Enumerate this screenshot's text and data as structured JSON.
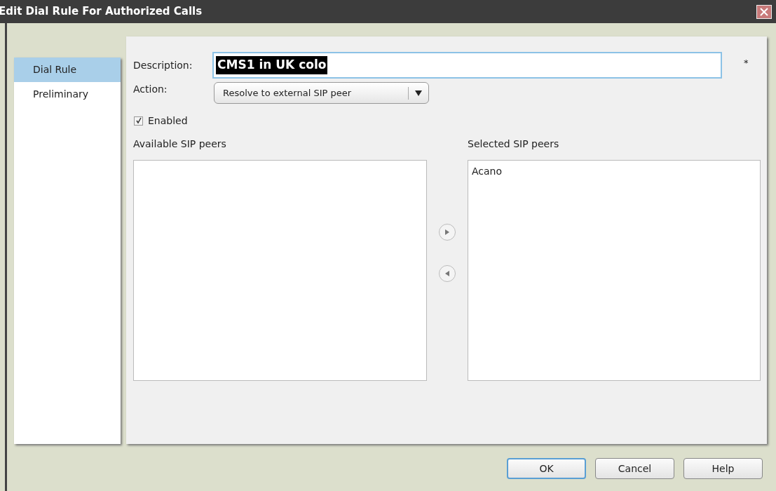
{
  "window": {
    "title": "Edit Dial Rule For Authorized Calls"
  },
  "sidebar": {
    "items": [
      {
        "label": "Dial Rule",
        "selected": true
      },
      {
        "label": "Preliminary",
        "selected": false
      }
    ]
  },
  "form": {
    "description": {
      "label": "Description:",
      "value": "CMS1 in UK colo",
      "value_selected": true,
      "required_mark": "*"
    },
    "action": {
      "label": "Action:",
      "value": "Resolve to external SIP peer"
    },
    "enabled": {
      "label": "Enabled",
      "checked": true
    }
  },
  "available_list": {
    "title": "Available SIP peers"
  },
  "selected_list": {
    "title": "Selected SIP peers",
    "items": [
      "Acano"
    ]
  },
  "buttons": [
    {
      "label": "OK",
      "default": true
    },
    {
      "label": "Cancel",
      "default": false
    },
    {
      "label": "Help",
      "default": false
    }
  ]
}
